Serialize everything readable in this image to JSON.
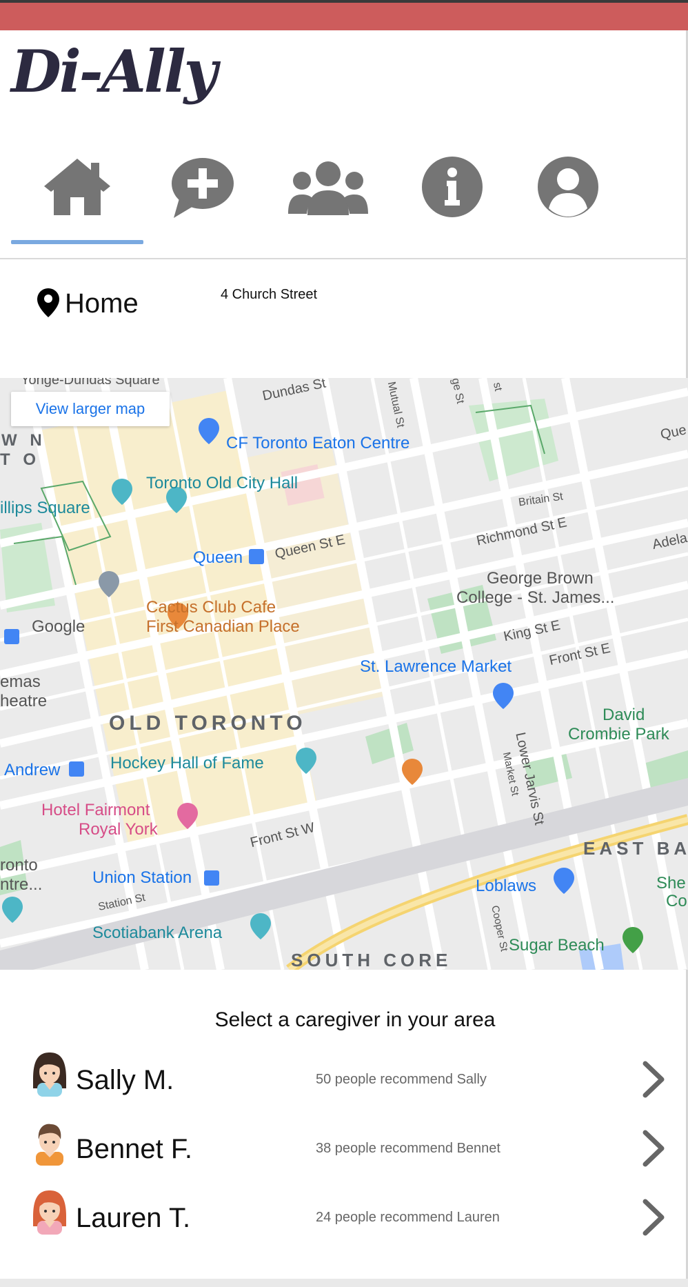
{
  "app": {
    "logo_text": "Di-Ally",
    "brand_color": "#cd5c5c",
    "accent": "#7aa9e0"
  },
  "nav": [
    {
      "icon": "home-icon",
      "active": true
    },
    {
      "icon": "chat-add-icon",
      "active": false
    },
    {
      "icon": "group-icon",
      "active": false
    },
    {
      "icon": "info-icon",
      "active": false
    },
    {
      "icon": "account-icon",
      "active": false
    }
  ],
  "location": {
    "label": "Home",
    "address": "4 Church Street"
  },
  "map": {
    "view_larger": "View larger map",
    "labels": {
      "eaton": "CF Toronto Eaton Centre",
      "city_hall": "Toronto Old City Hall",
      "queen": "Queen",
      "phillips": "illips Square",
      "google": "Google",
      "cactus1": "Cactus Club Cafe",
      "cactus2": "First Canadian Place",
      "george1": "George Brown",
      "george2": "College - St. James...",
      "st_lawrence": "St. Lawrence Market",
      "old_toronto": "OLD TORONTO",
      "hockey": "Hockey Hall of Fame",
      "andrew": "Andrew",
      "fairmont1": "Hotel Fairmont",
      "fairmont2": "Royal York",
      "union": "Union Station",
      "scotiabank": "Scotiabank Arena",
      "south_core": "SOUTH CORE",
      "loblaws": "Loblaws",
      "sugar_beach": "Sugar Beach",
      "east_bay": "EAST BA",
      "david1": "David",
      "david2": "Crombie Park",
      "emas": "emas",
      "heatre": "heatre",
      "wn": "W N",
      "to": "T O",
      "ronto": "ronto",
      "ntre": "ntre...",
      "she": "She",
      "co": "Co",
      "dundas_sq": "Yonge-Dundas Square",
      "dundas_st": "Dundas St",
      "queen_st": "Queen St E",
      "richmond": "Richmond St E",
      "king": "King St E",
      "front_e": "Front St E",
      "front_w": "Front St W",
      "britain": "Britain St",
      "lower_jarvis": "Lower Jarvis St",
      "market_st": "Market St",
      "station_st": "Station St",
      "cooper": "Cooper St",
      "mutual": "Mutual St",
      "adela": "Adela",
      "que": "Que",
      "ge_st": "ge St",
      "st": "st"
    }
  },
  "caregivers": {
    "heading": "Select a caregiver in your area",
    "items": [
      {
        "name": "Sally M.",
        "recommend": "50 people recommend Sally",
        "avatar": "woman-avatar-icon"
      },
      {
        "name": "Bennet F.",
        "recommend": "38 people recommend Bennet",
        "avatar": "man-avatar-icon"
      },
      {
        "name": "Lauren T.",
        "recommend": "24 people recommend Lauren",
        "avatar": "woman-red-hair-avatar-icon"
      }
    ]
  }
}
